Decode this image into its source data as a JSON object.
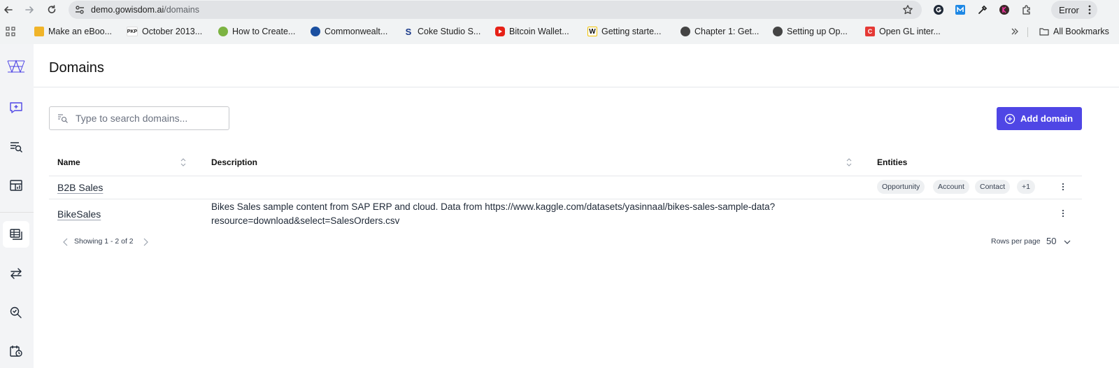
{
  "browser": {
    "url_host": "demo.gowisdom.ai",
    "url_path": "/domains",
    "profile_status": "Error",
    "bookmarks": [
      {
        "label": "Make an eBoo...",
        "icon": "ebook-favicon"
      },
      {
        "label": "October 2013...",
        "icon": "pkp-favicon",
        "icon_text": "PKP"
      },
      {
        "label": "How to Create...",
        "icon": "green-circle-favicon"
      },
      {
        "label": "Commonwealt...",
        "icon": "globe-favicon"
      },
      {
        "label": "Coke Studio S...",
        "icon": "s-favicon",
        "icon_text": "S"
      },
      {
        "label": "Bitcoin Wallet...",
        "icon": "youtube-favicon"
      },
      {
        "label": "Getting starte...",
        "icon": "w-favicon",
        "icon_text": "W"
      },
      {
        "label": "Chapter 1: Get...",
        "icon": "globe-favicon"
      },
      {
        "label": "Setting up Op...",
        "icon": "globe-favicon"
      },
      {
        "label": "Open GL inter...",
        "icon": "c-favicon",
        "icon_text": "C"
      }
    ],
    "all_bookmarks_label": "All Bookmarks"
  },
  "page": {
    "title": "Domains",
    "search_placeholder": "Type to search domains...",
    "add_button_label": "Add domain",
    "columns": [
      "Name",
      "Description",
      "Entities"
    ],
    "rows": [
      {
        "name": "B2B Sales",
        "description": "",
        "entities": [
          "Opportunity",
          "Account",
          "Contact",
          "+1"
        ]
      },
      {
        "name": "BikeSales",
        "description_line1": "Bikes Sales sample content from SAP ERP and cloud. Data from https://www.kaggle.com/datasets/yasinnaal/bikes-sales-sample-data?",
        "description_line2": "resource=download&select=SalesOrders.csv",
        "entities": []
      }
    ],
    "pagination_text": "Showing 1 - 2 of 2",
    "rows_per_page_label": "Rows per page",
    "rows_per_page_value": "50"
  },
  "colors": {
    "accent": "#4f46e5",
    "sidebar_icon": "#4f46e5"
  }
}
